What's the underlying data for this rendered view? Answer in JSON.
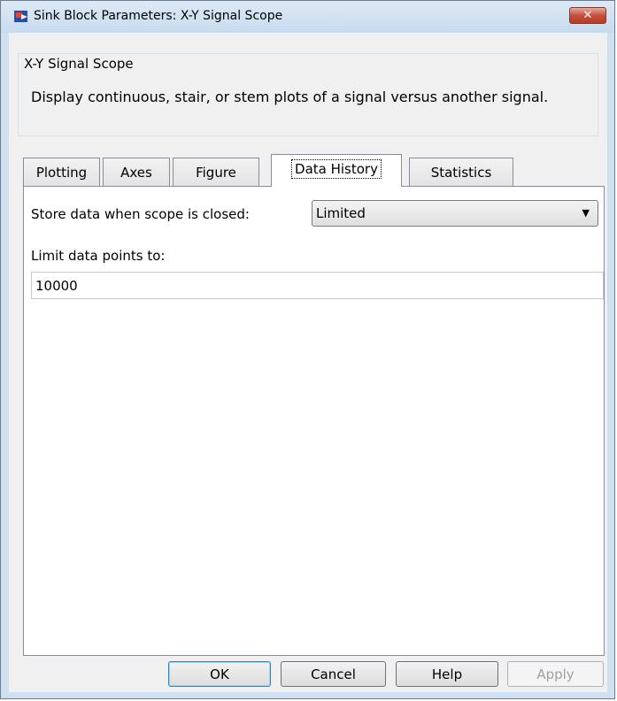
{
  "window": {
    "title": "Sink Block Parameters: X-Y Signal Scope",
    "close_symbol": "✕"
  },
  "block": {
    "name": "X-Y Signal Scope",
    "description": "Display continuous, stair, or stem plots of a signal versus another signal."
  },
  "tabs": [
    {
      "label": "Plotting",
      "active": false
    },
    {
      "label": "Axes",
      "active": false
    },
    {
      "label": "Figure",
      "active": false
    },
    {
      "label": "Data History",
      "active": true
    },
    {
      "label": "Statistics",
      "active": false
    }
  ],
  "data_history": {
    "store_label": "Store data when scope is closed:",
    "store_value": "Limited",
    "limit_label": "Limit data points to:",
    "limit_value": "10000"
  },
  "buttons": {
    "ok": "OK",
    "cancel": "Cancel",
    "help": "Help",
    "apply": "Apply"
  },
  "icons": {
    "app": "simulink-block-icon",
    "close": "close-icon",
    "dropdown": "chevron-down-icon"
  }
}
